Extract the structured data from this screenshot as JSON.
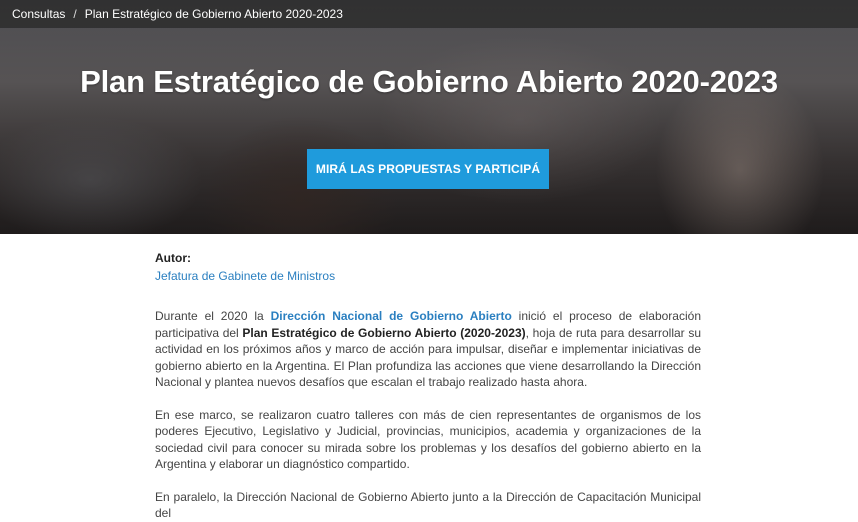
{
  "breadcrumb": {
    "items": [
      "Consultas",
      "Plan Estratégico de Gobierno Abierto 2020-2023"
    ],
    "separator": "/"
  },
  "hero": {
    "title": "Plan Estratégico de Gobierno Abierto 2020-2023",
    "cta_label": "MIRÁ LAS PROPUESTAS Y PARTICIPÁ"
  },
  "author": {
    "label": "Autor:",
    "name": "Jefatura de Gabinete de Ministros"
  },
  "paragraphs": {
    "p1": {
      "t1": "Durante el 2020 la ",
      "link": "Dirección Nacional de Gobierno Abierto",
      "t2": " inició el proceso de elaboración  participativa del ",
      "bold": "Plan Estratégico de Gobierno Abierto (2020-2023)",
      "t3": ", hoja de ruta para desarrollar su actividad en los próximos años y marco de acción para impulsar, diseñar e implementar iniciativas de gobierno abierto en la Argentina. El Plan profundiza las acciones que viene desarrollando la Dirección Nacional y plantea nuevos desafíos que escalan el trabajo realizado hasta ahora."
    },
    "p2": "En ese marco, se realizaron cuatro talleres con más de cien representantes de organismos de los poderes Ejecutivo, Legislativo y Judicial, provincias, municipios, academia y organizaciones de la sociedad civil para conocer su mirada sobre los problemas y los desafíos del gobierno abierto en la Argentina y elaborar un diagnóstico compartido.",
    "p3": "En paralelo, la Dirección Nacional de Gobierno Abierto junto a la Dirección de Capacitación Municipal del"
  },
  "colors": {
    "accent": "#1f9bdc",
    "link": "#2a7fc0"
  }
}
